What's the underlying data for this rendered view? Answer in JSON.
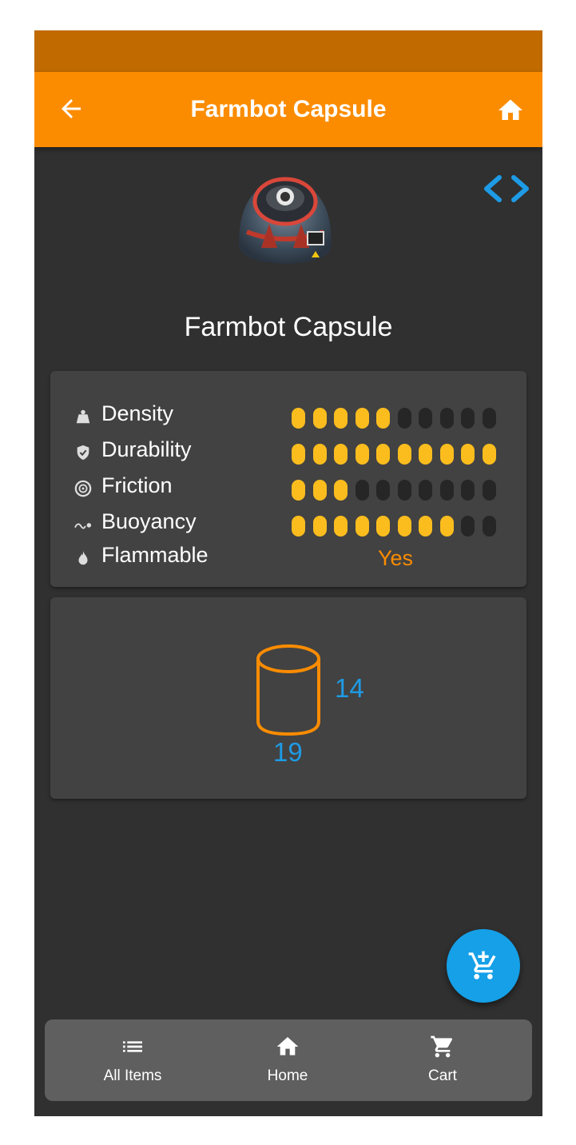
{
  "app_bar": {
    "title": "Farmbot Capsule",
    "back_icon": "arrow-left-icon",
    "home_icon": "home-icon",
    "color": "#fb8c00"
  },
  "item": {
    "name": "Farmbot Capsule",
    "image": "farmbot-capsule-image"
  },
  "stats": [
    {
      "label": "Density",
      "icon": "weight-icon",
      "level": 5,
      "max": 10
    },
    {
      "label": "Durability",
      "icon": "shield-icon",
      "level": 10,
      "max": 10
    },
    {
      "label": "Friction",
      "icon": "tire-icon",
      "level": 3,
      "max": 10
    },
    {
      "label": "Buoyancy",
      "icon": "buoyancy-icon",
      "level": 8,
      "max": 10
    },
    {
      "label": "Flammable",
      "icon": "flame-icon",
      "value": "Yes"
    }
  ],
  "size": {
    "height": "14",
    "diameter": "19",
    "icon": "cylinder-icon"
  },
  "fab": {
    "icon": "add-to-cart-icon",
    "color": "#15a0e8"
  },
  "bottom_nav": [
    {
      "label": "All Items",
      "icon": "list-icon"
    },
    {
      "label": "Home",
      "icon": "home-icon"
    },
    {
      "label": "Cart",
      "icon": "cart-icon"
    }
  ],
  "colors": {
    "accent": "#fb8c00",
    "dot_on": "#fbbd1e",
    "dot_off": "#262626",
    "value_blue": "#1e9be6",
    "background": "#303030",
    "card": "#424242"
  }
}
